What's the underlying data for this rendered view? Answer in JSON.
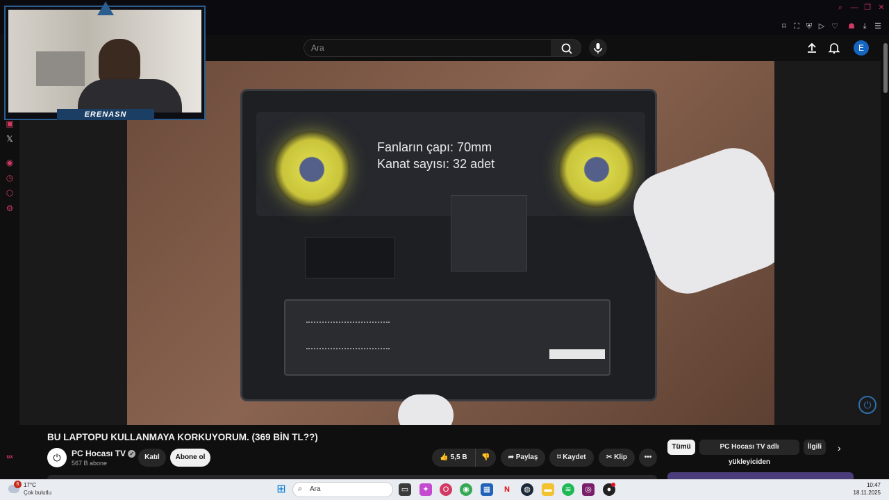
{
  "header": {
    "search_placeholder": "Ara",
    "avatar_letter": "E"
  },
  "webcam": {
    "streamer_name": "ERENASN"
  },
  "video": {
    "overlay_line1": "Fanların çapı: 70mm",
    "overlay_line2": "Kanat sayısı: 32 adet"
  },
  "meta": {
    "title": "BU LAPTOPU KULLANMAYA KORKUYORUM. (369 BİN TL??)",
    "channel_name": "PC Hocası TV",
    "channel_subs": "567 B abone",
    "join_label": "Katıl",
    "subscribe_label": "Abone ol",
    "likes": "5,5 B",
    "share_label": "Paylaş",
    "save_label": "Kaydet",
    "clip_label": "Klip",
    "more_label": "•••"
  },
  "chips": [
    {
      "label": "Tümü",
      "active": true
    },
    {
      "label": "PC Hocası TV adlı yükleyiciden",
      "active": false
    },
    {
      "label": "İlgili",
      "active": false
    }
  ],
  "rail": {
    "badge": "ux"
  },
  "taskbar": {
    "weather_temp": "17°C",
    "weather_desc": "Çok bulutlu",
    "weather_badge": "6",
    "search_placeholder": "Ara",
    "time": "10:47",
    "date": "18.11.2025"
  },
  "colors": {
    "accent": "#d23a63",
    "subscribe_bg": "#f1f1f1",
    "avatar_bg": "#1565c0"
  }
}
